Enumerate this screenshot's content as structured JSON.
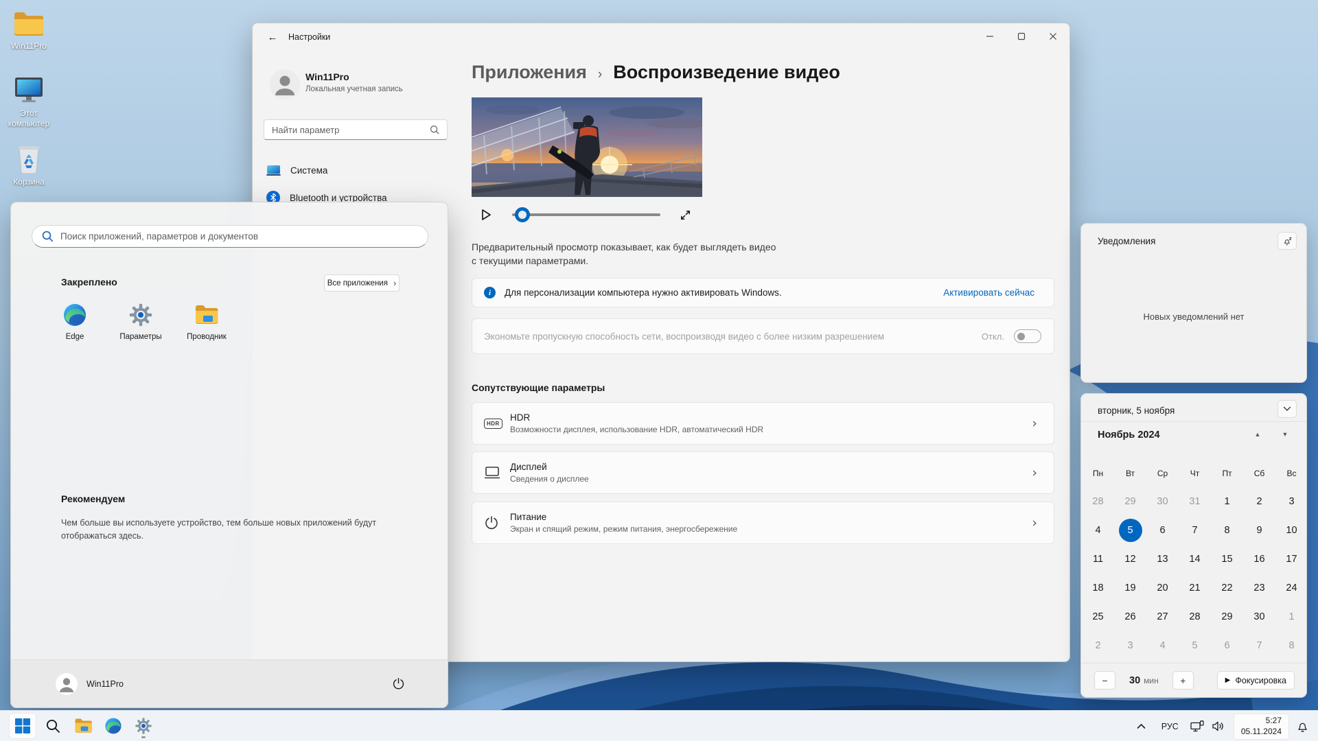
{
  "colors": {
    "accent": "#0067c0",
    "link": "#0067c0",
    "window_bg": "#f3f3f3",
    "card_bg": "#fbfbfb",
    "taskbar_bg": "#eff3f8",
    "selected_day_bg": "#0067c0"
  },
  "desktop": {
    "icons": [
      {
        "icon": "folder-icon",
        "label": "Win11Pro"
      },
      {
        "icon": "computer-icon",
        "label": "Этот компьютер"
      },
      {
        "icon": "recycle-bin-icon",
        "label": "Корзина"
      }
    ]
  },
  "settings_window": {
    "title": "Настройки",
    "account": {
      "name": "Win11Pro",
      "type": "Локальная учетная запись"
    },
    "sidebar_search_placeholder": "Найти параметр",
    "nav": [
      {
        "icon": "system-icon",
        "label": "Система"
      },
      {
        "icon": "bluetooth-icon",
        "label": "Bluetooth и устройства"
      }
    ],
    "breadcrumb": {
      "parent": "Приложения",
      "current": "Воспроизведение видео"
    },
    "preview_note": "Предварительный просмотр показывает, как будет выглядеть видео с текущими параметрами.",
    "activation": {
      "message": "Для персонализации компьютера нужно активировать Windows.",
      "action": "Активировать сейчас"
    },
    "bandwidth": {
      "label": "Экономьте пропускную способность сети, воспроизводя видео с более низким разрешением",
      "state_label": "Откл."
    },
    "related": {
      "title": "Сопутствующие параметры",
      "items": [
        {
          "icon": "hdr-icon",
          "badge": "HDR",
          "title": "HDR",
          "subtitle": "Возможности дисплея, использование HDR, автоматический HDR"
        },
        {
          "icon": "display-icon",
          "title": "Дисплей",
          "subtitle": "Сведения о дисплее"
        },
        {
          "icon": "power-icon",
          "title": "Питание",
          "subtitle": "Экран и спящий режим, режим питания, энергосбережение"
        }
      ]
    }
  },
  "start_menu": {
    "search_placeholder": "Поиск приложений, параметров и документов",
    "pinned_title": "Закреплено",
    "all_apps_label": "Все приложения",
    "apps": [
      {
        "icon": "edge-icon",
        "label": "Edge"
      },
      {
        "icon": "settings-gear-icon",
        "label": "Параметры"
      },
      {
        "icon": "explorer-folder-icon",
        "label": "Проводник"
      }
    ],
    "recommended_title": "Рекомендуем",
    "recommended_text": "Чем больше вы используете устройство, тем больше новых приложений будут отображаться здесь.",
    "user_name": "Win11Pro"
  },
  "notifications": {
    "title": "Уведомления",
    "empty_text": "Новых уведомлений нет"
  },
  "calendar": {
    "date_header": "вторник, 5 ноября",
    "month_label": "Ноябрь 2024",
    "weekdays": [
      "Пн",
      "Вт",
      "Ср",
      "Чт",
      "Пт",
      "Сб",
      "Вс"
    ],
    "weeks": [
      [
        {
          "d": 28,
          "muted": true
        },
        {
          "d": 29,
          "muted": true
        },
        {
          "d": 30,
          "muted": true
        },
        {
          "d": 31,
          "muted": true
        },
        {
          "d": 1
        },
        {
          "d": 2
        },
        {
          "d": 3
        }
      ],
      [
        {
          "d": 4
        },
        {
          "d": 5,
          "selected": true
        },
        {
          "d": 6
        },
        {
          "d": 7
        },
        {
          "d": 8
        },
        {
          "d": 9
        },
        {
          "d": 10
        }
      ],
      [
        {
          "d": 11
        },
        {
          "d": 12
        },
        {
          "d": 13
        },
        {
          "d": 14
        },
        {
          "d": 15
        },
        {
          "d": 16
        },
        {
          "d": 17
        }
      ],
      [
        {
          "d": 18
        },
        {
          "d": 19
        },
        {
          "d": 20
        },
        {
          "d": 21
        },
        {
          "d": 22
        },
        {
          "d": 23
        },
        {
          "d": 24
        }
      ],
      [
        {
          "d": 25
        },
        {
          "d": 26
        },
        {
          "d": 27
        },
        {
          "d": 28
        },
        {
          "d": 29
        },
        {
          "d": 30
        },
        {
          "d": 1,
          "muted": true
        }
      ],
      [
        {
          "d": 2,
          "muted": true
        },
        {
          "d": 3,
          "muted": true
        },
        {
          "d": 4,
          "muted": true
        },
        {
          "d": 5,
          "muted": true
        },
        {
          "d": 6,
          "muted": true
        },
        {
          "d": 7,
          "muted": true
        },
        {
          "d": 8,
          "muted": true
        }
      ]
    ],
    "selected_day": 5,
    "focus_minutes": "30",
    "focus_unit": "мин",
    "focus_button": "Фокусировка"
  },
  "taskbar": {
    "language": "РУС",
    "time": "5:27",
    "date": "05.11.2024"
  }
}
